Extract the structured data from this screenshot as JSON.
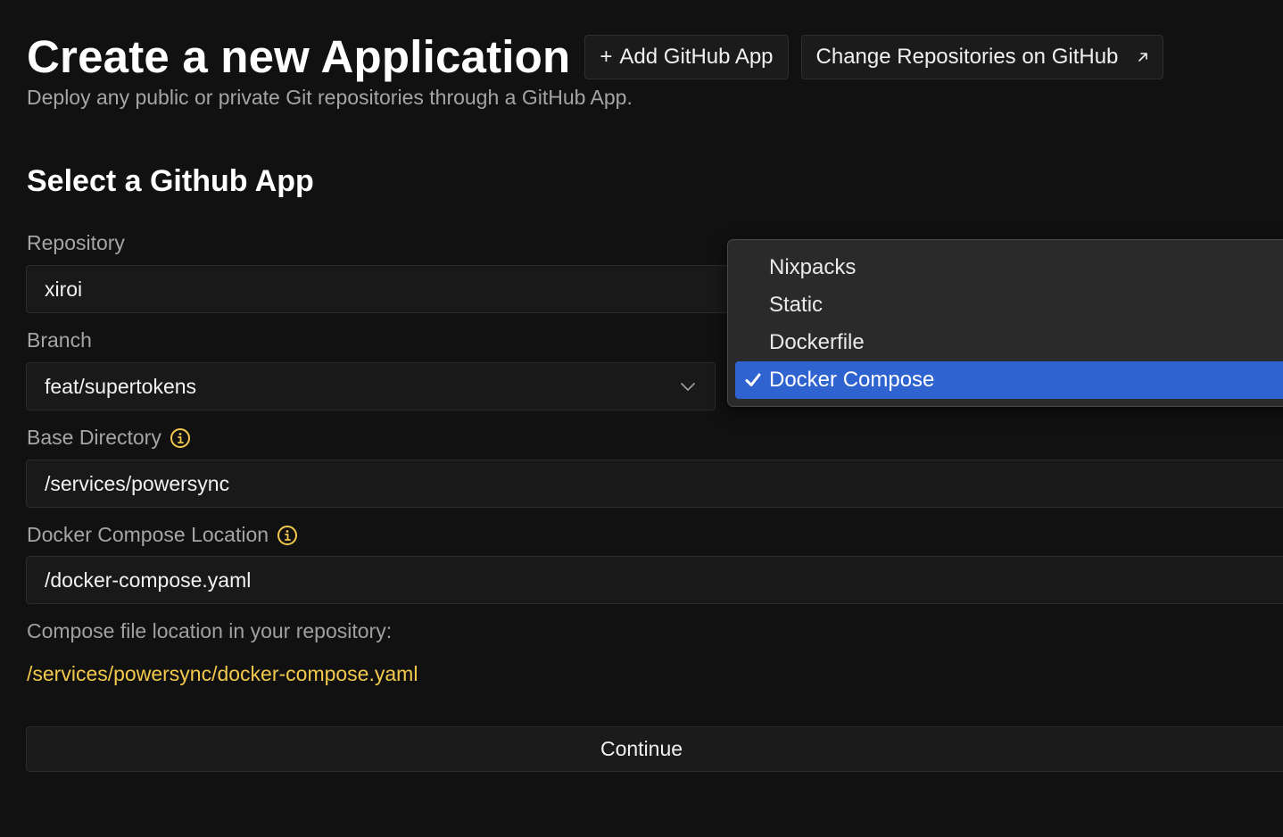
{
  "header": {
    "title": "Create a new Application",
    "add_button": "Add GitHub App",
    "add_plus": "+",
    "change_button": "Change Repositories on GitHub",
    "subtitle": "Deploy any public or private Git repositories through a GitHub App."
  },
  "section": {
    "title": "Select a Github App"
  },
  "form": {
    "repository": {
      "label": "Repository",
      "value": "xiroi"
    },
    "branch": {
      "label": "Branch",
      "value": "feat/supertokens"
    },
    "base_directory": {
      "label": "Base Directory",
      "value": "/services/powersync"
    },
    "compose_location": {
      "label": "Docker Compose Location",
      "value": "/docker-compose.yaml"
    },
    "compose_hint": "Compose file location in your repository:",
    "compose_path": "/services/powersync/docker-compose.yaml",
    "continue_label": "Continue"
  },
  "build_pack_dropdown": {
    "options": [
      "Nixpacks",
      "Static",
      "Dockerfile",
      "Docker Compose"
    ],
    "selected": "Docker Compose"
  },
  "colors": {
    "background": "#111111",
    "accent_yellow": "#f2c94c",
    "selection_blue": "#2f63d0"
  },
  "icons": {
    "info": "info-circle-icon",
    "chevron": "chevron-down-icon",
    "external": "arrow-up-right-icon",
    "check": "checkmark-icon"
  }
}
